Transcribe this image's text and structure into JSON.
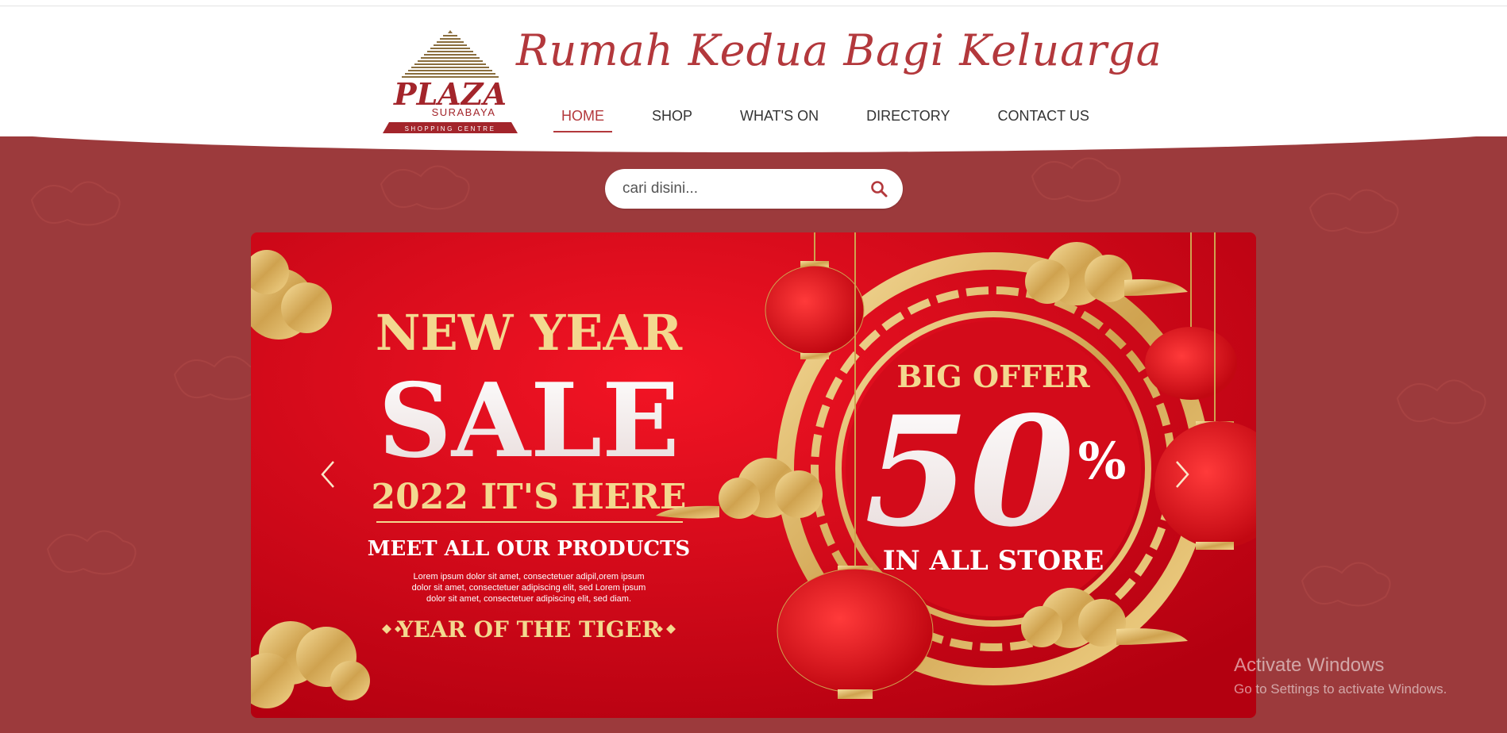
{
  "header": {
    "tagline": "Rumah Kedua Bagi Keluarga",
    "logo": {
      "main": "PLAZA",
      "sub": "SURABAYA",
      "small": "SHOPPING CENTRE"
    }
  },
  "nav": {
    "items": [
      {
        "label": "HOME",
        "active": true
      },
      {
        "label": "SHOP",
        "active": false
      },
      {
        "label": "WHAT'S ON",
        "active": false
      },
      {
        "label": "DIRECTORY",
        "active": false
      },
      {
        "label": "CONTACT US",
        "active": false
      }
    ]
  },
  "search": {
    "placeholder": "cari disini...",
    "icon": "search-icon"
  },
  "banner": {
    "line1": "NEW YEAR",
    "line2": "SALE",
    "line3": "2022 IT'S HERE",
    "line4": "MEET ALL OUR PRODUCTS",
    "lorem1": "Lorem ipsum dolor sit amet, consectetuer adipil,orem ipsum",
    "lorem2": "dolor sit amet, consectetuer adipiscing elit, sed Lorem ipsum",
    "lorem3": "dolor sit amet, consectetuer adipiscing elit, sed diam.",
    "line5": "YEAR OF THE TIGER",
    "offer": "BIG OFFER",
    "percent": "50",
    "percent_sign": "%",
    "store": "IN ALL STORE"
  },
  "carousel": {
    "prev_icon": "chevron-left-icon",
    "next_icon": "chevron-right-icon"
  },
  "watermark": {
    "title": "Activate Windows",
    "subtitle": "Go to Settings to activate Windows."
  },
  "colors": {
    "brand": "#b3383c",
    "hero_bg": "#9c3a3c",
    "banner_red": "#e0101e",
    "gold": "#e9c77b"
  }
}
